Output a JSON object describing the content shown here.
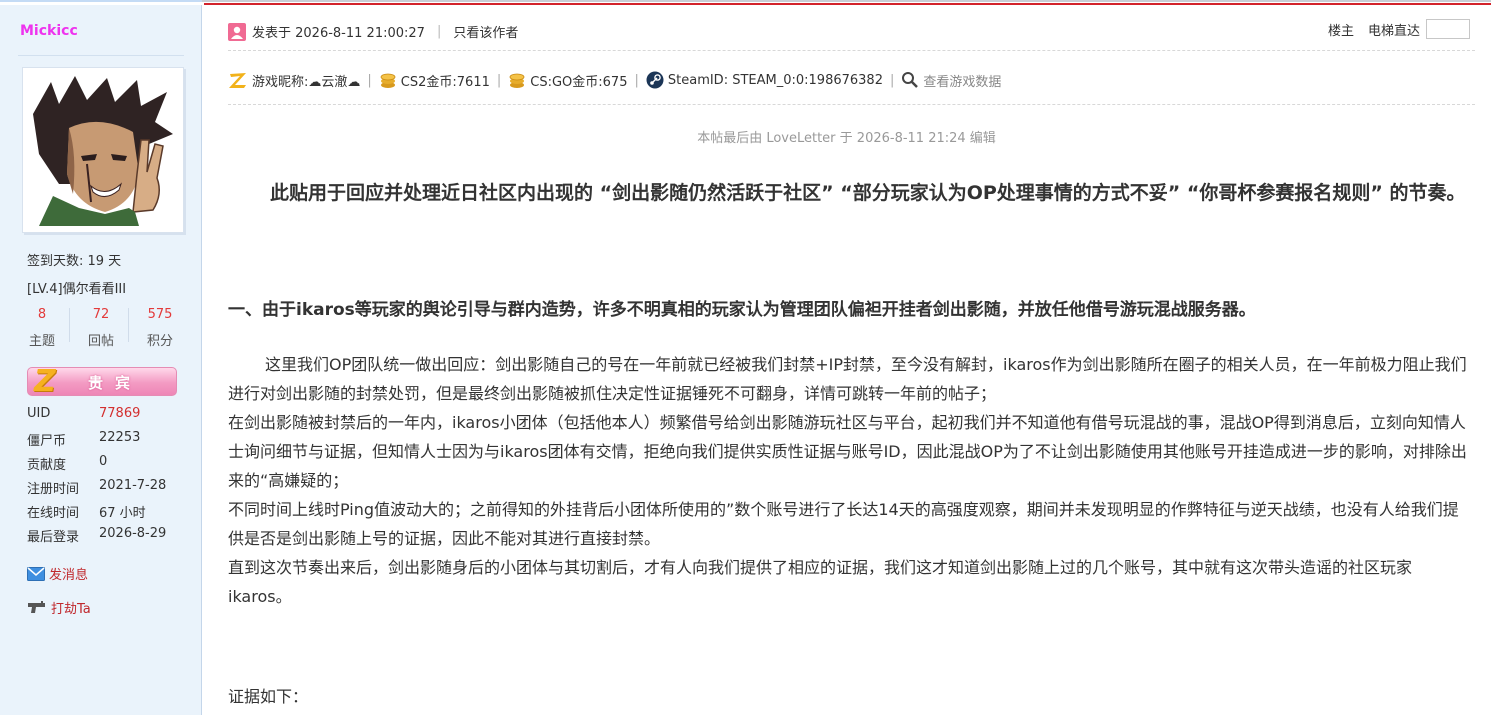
{
  "user": {
    "name": "Mickicc",
    "sign_days": "签到天数: 19 天",
    "level": "[LV.4]偶尔看看III",
    "stats": [
      {
        "num": "8",
        "label": "主题"
      },
      {
        "num": "72",
        "label": "回帖"
      },
      {
        "num": "575",
        "label": "积分"
      }
    ],
    "badge": {
      "text": "贵宾"
    },
    "info": [
      {
        "label": "UID",
        "value": "77869"
      },
      {
        "label": "僵尸币",
        "value": "22253"
      },
      {
        "label": "贡献度",
        "value": "0"
      },
      {
        "label": "注册时间",
        "value": "2021-7-28"
      },
      {
        "label": "在线时间",
        "value": "67 小时"
      },
      {
        "label": "最后登录",
        "value": "2026-8-29"
      }
    ],
    "actions": {
      "message": "发消息",
      "rob": "打劫Ta"
    }
  },
  "post": {
    "posted_at": "发表于 2026-8-11 21:00:27",
    "sep": "|",
    "only_author": "只看该作者",
    "floor_label": "楼主",
    "jump_label": "电梯直达",
    "game": {
      "nickname_label": "游戏昵称:",
      "nickname": "☁云澈☁",
      "cs2_coins": "CS2金币:7611",
      "csgo_coins": "CS:GO金币:675",
      "steam_id": "SteamID: STEAM_0:0:198676382",
      "view_data": "查看游戏数据"
    },
    "edited": "本帖最后由 LoveLetter 于 2026-8-11 21:24 编辑",
    "intro": "此贴用于回应并处理近日社区内出现的 “剑出影随仍然活跃于社区” “部分玩家认为OP处理事情的方式不妥” “你哥杯参赛报名规则” 的节奏。",
    "section1": "一、由于ikaros等玩家的舆论引导与群内造势，许多不明真相的玩家认为管理团队偏袒开挂者剑出影随，并放任他借号游玩混战服务器。",
    "paragraphs": [
      "这里我们OP团队统一做出回应：剑出影随自己的号在一年前就已经被我们封禁+IP封禁，至今没有解封，ikaros作为剑出影随所在圈子的相关人员，在一年前极力阻止我们进行对剑出影随的封禁处罚，但是最终剑出影随被抓住决定性证据锤死不可翻身，详情可跳转一年前的帖子；",
      "在剑出影随被封禁后的一年内，ikaros小团体（包括他本人）频繁借号给剑出影随游玩社区与平台，起初我们并不知道他有借号玩混战的事，混战OP得到消息后，立刻向知情人士询问细节与证据，但知情人士因为与ikaros团体有交情，拒绝向我们提供实质性证据与账号ID，因此混战OP为了不让剑出影随使用其他账号开挂造成进一步的影响，对排除出来的“高嫌疑的；",
      "不同时间上线时Ping值波动大的；之前得知的外挂背后小团体所使用的”数个账号进行了长达14天的高强度观察，期间并未发现明显的作弊特征与逆天战绩，也没有人给我们提供是否是剑出影随上号的证据，因此不能对其进行直接封禁。",
      "直到这次节奏出来后，剑出影随身后的小团体与其切割后，才有人向我们提供了相应的证据，我们这才知道剑出影随上过的几个账号，其中就有这次带头造谣的社区玩家ikaros。"
    ],
    "evidence": "证据如下："
  }
}
